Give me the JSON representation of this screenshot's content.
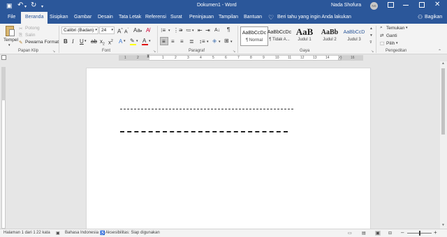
{
  "title_bar": {
    "doc_title": "Dokumen1 - Word",
    "user_name": "Nada Shofura",
    "avatar_initials": "NS"
  },
  "tabs": [
    "File",
    "Beranda",
    "Sisipkan",
    "Gambar",
    "Desain",
    "Tata Letak",
    "Referensi",
    "Surat",
    "Peninjauan",
    "Tampilan",
    "Bantuan"
  ],
  "tell_me": "Beri tahu yang ingin Anda lakukan",
  "share_label": "Bagikan",
  "clipboard": {
    "paste": "Tempel",
    "cut": "Potong",
    "copy": "Salin",
    "format_painter": "Pewarna Format",
    "group_label": "Papan Klip"
  },
  "font": {
    "name": "Calibri (Badan)",
    "size": "24",
    "group_label": "Font"
  },
  "paragraph": {
    "group_label": "Paragraf"
  },
  "styles": {
    "items": [
      {
        "sample": "AaBbCcDc",
        "name": "¶ Normal"
      },
      {
        "sample": "AaBbCcDc",
        "name": "¶ Tidak A..."
      },
      {
        "sample": "AaB",
        "name": "Judul 1"
      },
      {
        "sample": "AaBb",
        "name": "Judul 2"
      },
      {
        "sample": "AaBbCcD",
        "name": "Judul 3"
      }
    ],
    "group_label": "Gaya"
  },
  "editing": {
    "find": "Temukan",
    "replace": "Ganti",
    "select": "Pilih",
    "group_label": "Pengeditan"
  },
  "ruler_numbers": [
    "1",
    "2",
    "1",
    "2",
    "3",
    "4",
    "5",
    "6",
    "7",
    "8",
    "9",
    "10",
    "11",
    "12",
    "13",
    "14",
    "15",
    "16",
    "17",
    "18"
  ],
  "status": {
    "page": "Halaman 1 dari 1",
    "words": "22 kata",
    "language": "Bahasa Indonesia",
    "accessibility": "Aksesibilitas: Siap digunakan"
  },
  "colors": {
    "brand": "#2b579a",
    "highlight": "#ffff00",
    "font_color": "#e00000"
  }
}
